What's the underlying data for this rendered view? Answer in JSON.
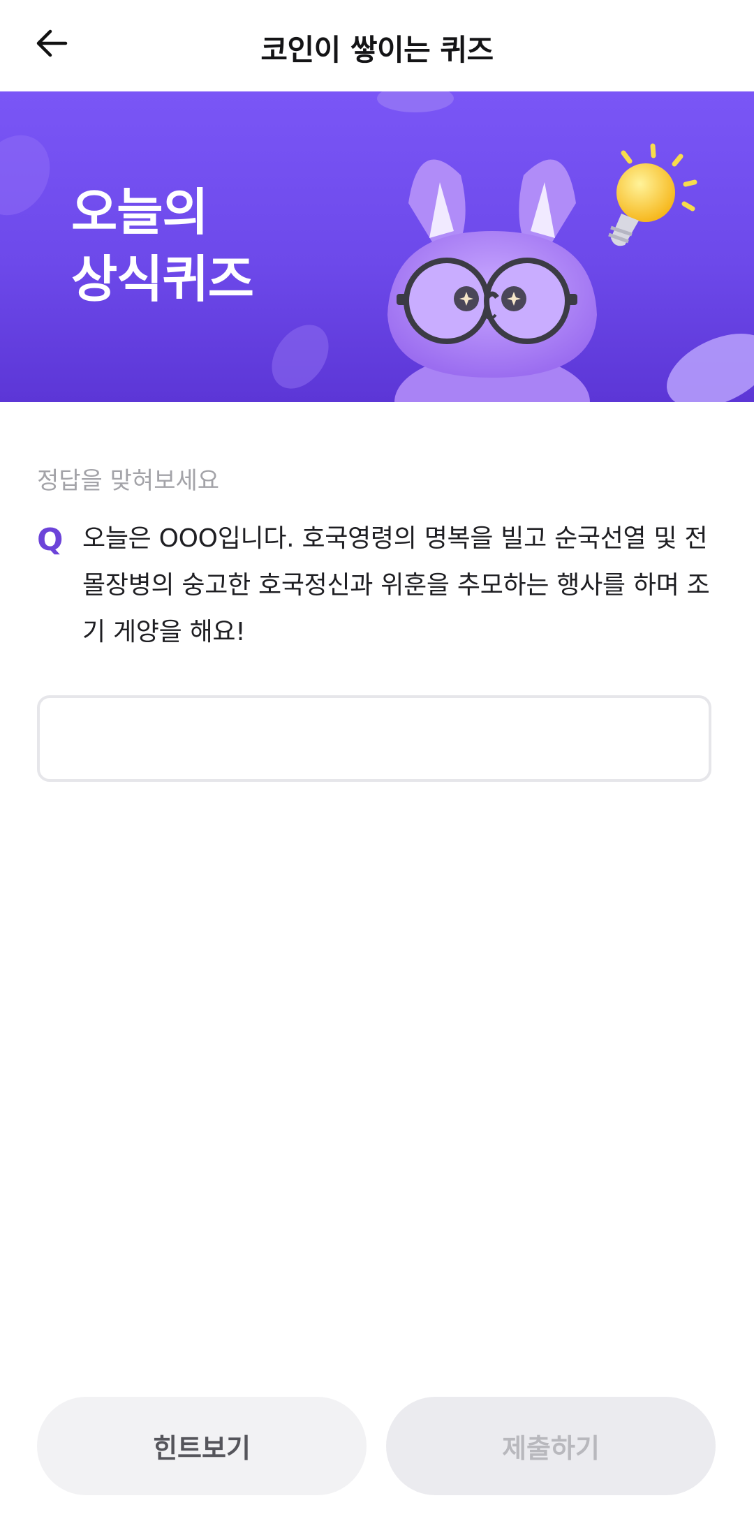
{
  "header": {
    "title": "코인이 쌓이는 퀴즈",
    "back_icon": "arrow-left-icon"
  },
  "banner": {
    "title_line1": "오늘의",
    "title_line2": "상식퀴즈",
    "background": "#7351f0",
    "illustration": "purple-dragon-with-glasses",
    "lightbulb_icon": "lightbulb-icon"
  },
  "quiz": {
    "prompt": "정답을 맞혀보세요",
    "q_marker": "Q",
    "question": "오늘은 OOO입니다. 호국영령의 명복을 빌고 순국선열 및 전몰장병의 숭고한 호국정신과 위훈을 추모하는 행사를 하며 조기 게양을 해요!",
    "answer_value": "",
    "answer_placeholder": ""
  },
  "buttons": {
    "hint_label": "힌트보기",
    "submit_label": "제출하기"
  },
  "colors": {
    "accent": "#6c43d9",
    "banner": "#7351f0"
  }
}
